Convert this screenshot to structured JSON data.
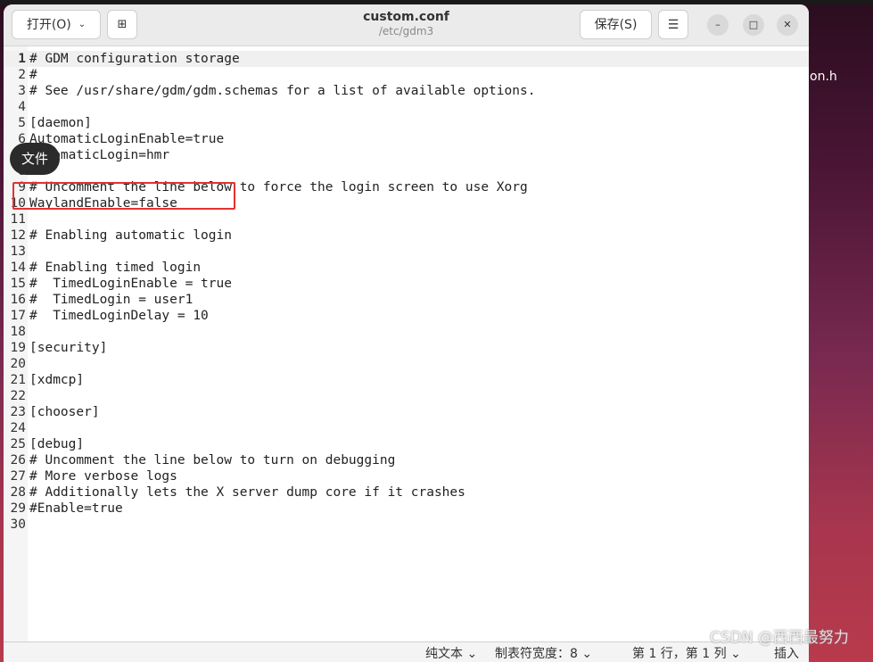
{
  "desktop": {
    "label": "on.h"
  },
  "header": {
    "open_label": "打开(O)",
    "title": "custom.conf",
    "subtitle": "/etc/gdm3",
    "save_label": "保存(S)"
  },
  "editor": {
    "current_line": 1,
    "lines": [
      "# GDM configuration storage",
      "#",
      "# See /usr/share/gdm/gdm.schemas for a list of available options.",
      "",
      "[daemon]",
      "AutomaticLoginEnable=true",
      "AutomaticLogin=hmr",
      "",
      "# Uncomment the line below to force the login screen to use Xorg",
      "WaylandEnable=false",
      "",
      "# Enabling automatic login",
      "",
      "# Enabling timed login",
      "#  TimedLoginEnable = true",
      "#  TimedLogin = user1",
      "#  TimedLoginDelay = 10",
      "",
      "[security]",
      "",
      "[xdmcp]",
      "",
      "[chooser]",
      "",
      "[debug]",
      "# Uncomment the line below to turn on debugging",
      "# More verbose logs",
      "# Additionally lets the X server dump core if it crashes",
      "#Enable=true",
      ""
    ]
  },
  "tooltip": "文件",
  "status": {
    "syntax": "纯文本",
    "tab_width": "制表符宽度：8",
    "position": "第 1 行，第 1 列",
    "mode": "插入"
  },
  "watermark": "CSDN @西西最努力",
  "colors": {
    "highlight_box": "#e53030"
  }
}
